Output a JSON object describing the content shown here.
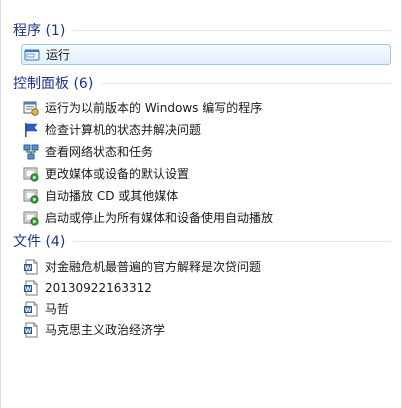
{
  "sections": [
    {
      "title": "程序 (1)",
      "items": [
        {
          "label": "运行",
          "icon": "run-icon"
        }
      ]
    },
    {
      "title": "控制面板 (6)",
      "items": [
        {
          "label": "运行为以前版本的 Windows 编写的程序",
          "icon": "compat-program-icon"
        },
        {
          "label": "检查计算机的状态并解决问题",
          "icon": "flag-icon"
        },
        {
          "label": "查看网络状态和任务",
          "icon": "network-icon"
        },
        {
          "label": "更改媒体或设备的默认设置",
          "icon": "autoplay-icon"
        },
        {
          "label": "自动播放 CD 或其他媒体",
          "icon": "autoplay-icon"
        },
        {
          "label": "启动或停止为所有媒体和设备使用自动播放",
          "icon": "autoplay-icon"
        }
      ]
    },
    {
      "title": "文件 (4)",
      "items": [
        {
          "label": "对金融危机最普遍的官方解释是次贷问题",
          "icon": "word-document-icon"
        },
        {
          "label": "20130922163312",
          "icon": "word-document-icon"
        },
        {
          "label": "马哲",
          "icon": "word-document-icon"
        },
        {
          "label": "马克思主义政治经济学",
          "icon": "word-document-icon"
        }
      ]
    }
  ],
  "colors": {
    "header": "#1e3287",
    "selection_border": "#9fc8ee",
    "selection_bg": "#e1effc"
  }
}
